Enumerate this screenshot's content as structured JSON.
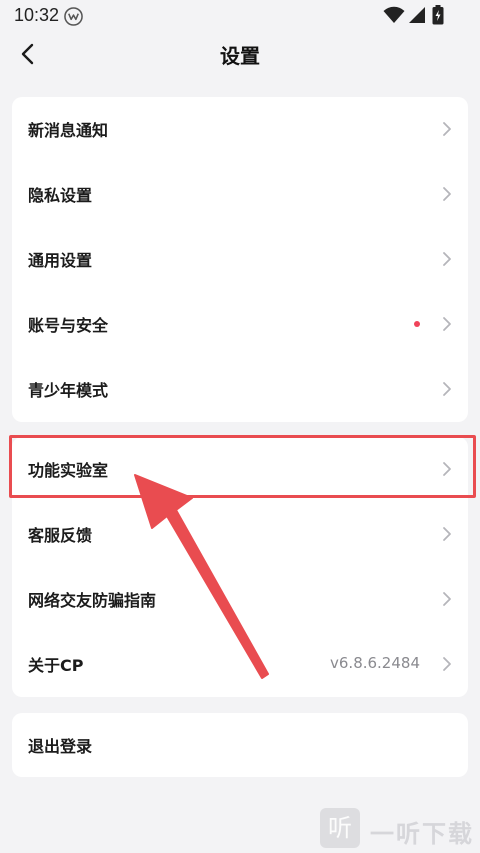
{
  "status_bar": {
    "time": "10:32"
  },
  "header": {
    "title": "设置"
  },
  "group1": [
    {
      "label": "新消息通知"
    },
    {
      "label": "隐私设置"
    },
    {
      "label": "通用设置"
    },
    {
      "label": "账号与安全"
    },
    {
      "label": "青少年模式"
    }
  ],
  "group2": [
    {
      "label": "功能实验室"
    },
    {
      "label": "客服反馈"
    },
    {
      "label": "网络交友防骗指南"
    },
    {
      "label": "关于CP",
      "value": "v6.8.6.2484"
    }
  ],
  "logout": {
    "label": "退出登录"
  },
  "watermark": {
    "glyph": "听",
    "text": "一听下载"
  },
  "colors": {
    "accent_red": "#e94c50",
    "badge_dot": "#f0435a",
    "background": "#f3f3f5"
  }
}
